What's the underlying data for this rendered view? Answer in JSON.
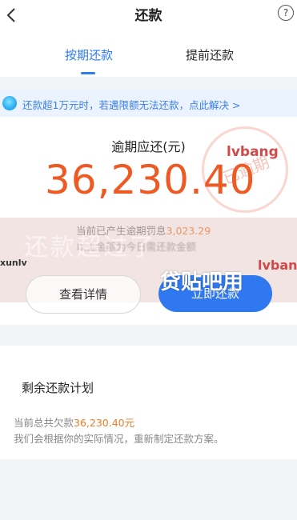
{
  "header": {
    "title": "还款",
    "help_icon_glyph": "?"
  },
  "tabs": [
    {
      "label": "按期还款",
      "active": true
    },
    {
      "label": "提前还款",
      "active": false
    }
  ],
  "notice": {
    "text": "还款超1万元时，若遇限额无法还款，点此解决 >"
  },
  "overdue": {
    "label": "逾期应还(元)",
    "amount": "36,230.40",
    "stamp_text": "已逾期",
    "penalty_prefix": "当前已产生逾期罚息",
    "penalty_amount": "3,023.29",
    "blurred_line": "以上金额为今日需还款金额"
  },
  "overlay": {
    "ghost_text": "还款超过了"
  },
  "buttons": {
    "detail": "查看详情",
    "repay": "立即还款"
  },
  "plan": {
    "title": "剩余还款计划",
    "total_prefix": "当前总共欠款",
    "total_amount": "36,230.40元",
    "description": "我们会根据你的实际情况，重新制定还款方案。"
  },
  "watermarks": {
    "brand_top": "lvbang",
    "brand_right": "lvban",
    "left": "xunlv",
    "center": "贷贴吧用"
  },
  "colors": {
    "accent_blue": "#2f7bf2",
    "amount_orange": "#ee5a24",
    "brand_red": "#cf3b3b"
  }
}
